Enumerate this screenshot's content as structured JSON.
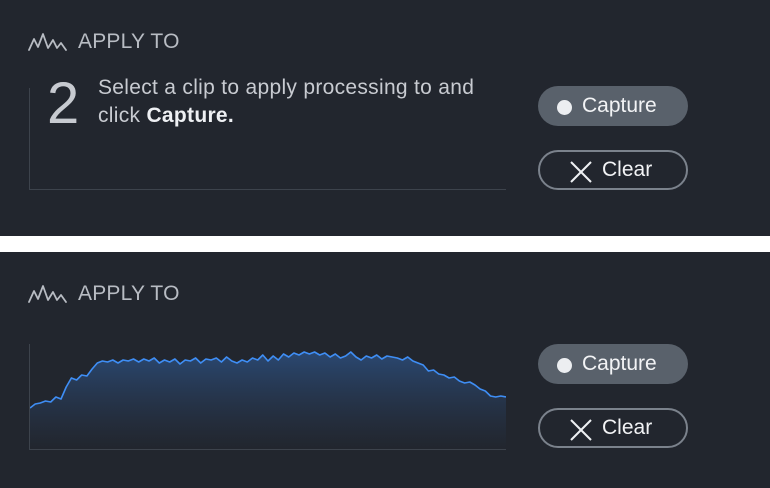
{
  "panels": [
    {
      "header": {
        "icon": "waveform-icon",
        "title": "APPLY TO"
      },
      "step": {
        "number": "2",
        "text": "Select a clip to apply processing to and click ",
        "emphasis": "Capture."
      },
      "buttons": {
        "capture_label": "Capture",
        "clear_label": "Clear"
      }
    },
    {
      "header": {
        "icon": "waveform-icon",
        "title": "APPLY TO"
      },
      "waveform": {
        "accent_color": "#3f8ef5",
        "fill_top_color": "#2b4a75",
        "levels": [
          0.41,
          0.45,
          0.46,
          0.48,
          0.47,
          0.52,
          0.5,
          0.62,
          0.71,
          0.69,
          0.74,
          0.73,
          0.8,
          0.86,
          0.88,
          0.87,
          0.89,
          0.86,
          0.89,
          0.88,
          0.9,
          0.87,
          0.9,
          0.88,
          0.91,
          0.86,
          0.89,
          0.87,
          0.9,
          0.85,
          0.89,
          0.88,
          0.91,
          0.86,
          0.9,
          0.89,
          0.91,
          0.87,
          0.92,
          0.88,
          0.86,
          0.89,
          0.87,
          0.91,
          0.89,
          0.94,
          0.88,
          0.93,
          0.89,
          0.95,
          0.92,
          0.96,
          0.94,
          0.97,
          0.95,
          0.97,
          0.94,
          0.96,
          0.92,
          0.95,
          0.91,
          0.93,
          0.97,
          0.92,
          0.89,
          0.93,
          0.91,
          0.94,
          0.9,
          0.93,
          0.92,
          0.91,
          0.89,
          0.92,
          0.88,
          0.86,
          0.84,
          0.78,
          0.79,
          0.75,
          0.74,
          0.71,
          0.72,
          0.68,
          0.66,
          0.67,
          0.64,
          0.6,
          0.58,
          0.53,
          0.52,
          0.53,
          0.52
        ]
      },
      "buttons": {
        "capture_label": "Capture",
        "clear_label": "Clear"
      }
    }
  ]
}
